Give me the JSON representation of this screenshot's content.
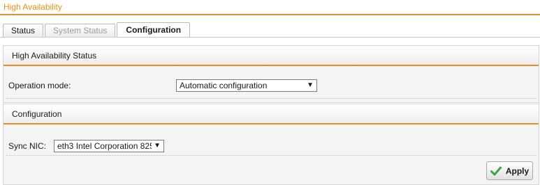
{
  "page": {
    "title": "High Availability"
  },
  "tabs": [
    {
      "label": "Status",
      "state": "normal"
    },
    {
      "label": "System Status",
      "state": "disabled"
    },
    {
      "label": "Configuration",
      "state": "active"
    }
  ],
  "ha_status_panel": {
    "title": "High Availability Status",
    "operation_mode": {
      "label": "Operation mode:",
      "value": "Automatic configuration"
    }
  },
  "config_panel": {
    "title": "Configuration",
    "sync_nic": {
      "label": "Sync NIC:",
      "value": "eth3 Intel Corporation 825"
    },
    "apply_label": "Apply"
  },
  "colors": {
    "accent": "#e8901e",
    "check_green": "#3aa53a"
  },
  "icons": {
    "dropdown": "triangle-down",
    "apply": "check-icon"
  }
}
